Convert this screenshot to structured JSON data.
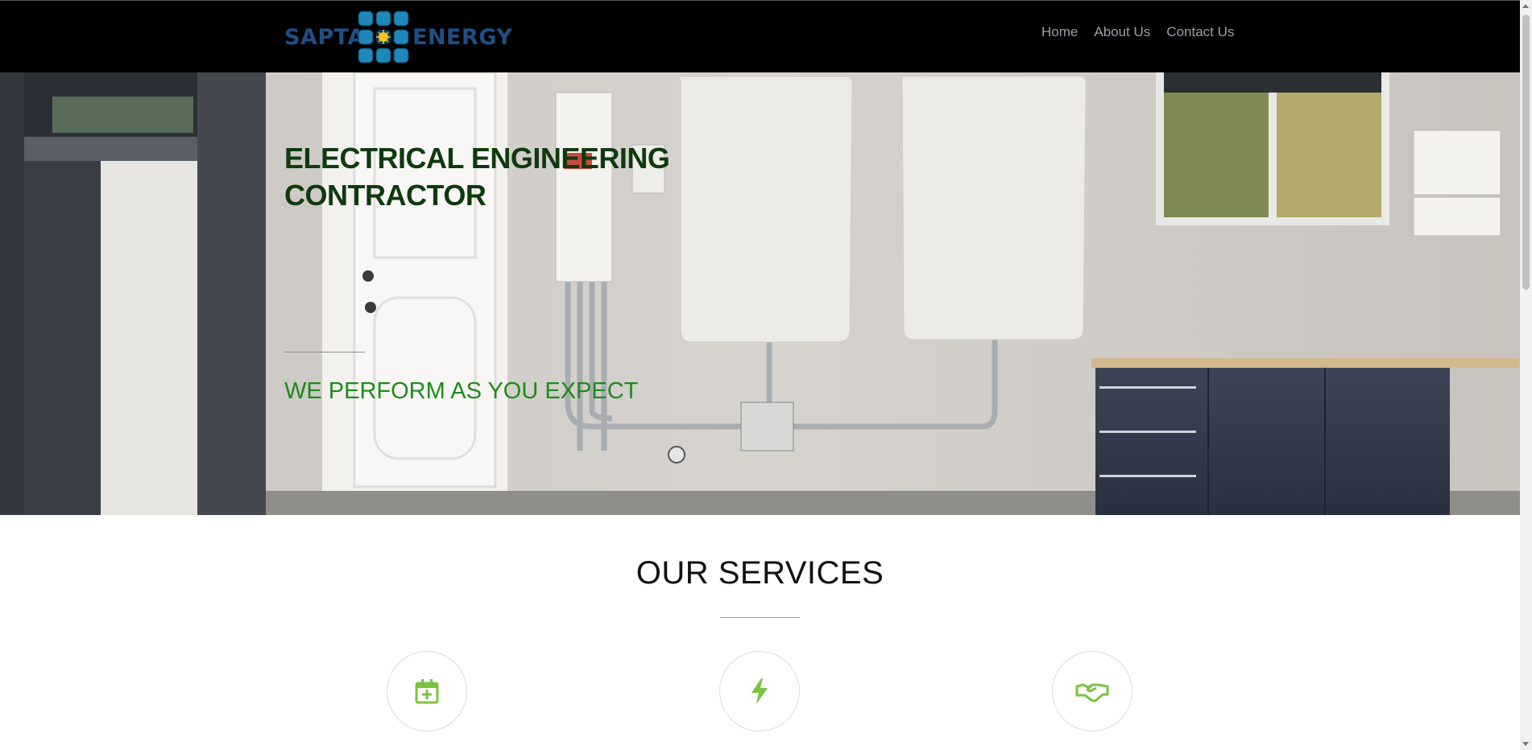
{
  "brand": {
    "name_left": "SAPTA",
    "name_right": "ENERGY",
    "panel_color": "#1e88b8",
    "sun_color": "#f5c518"
  },
  "nav": {
    "items": [
      "Home",
      "About Us",
      "Contact Us"
    ]
  },
  "hero": {
    "title_line1": "ELECTRICAL ENGINEERING",
    "title_line2": "CONTRACTOR",
    "tagline": "WE PERFORM AS YOU EXPECT"
  },
  "services": {
    "title": "OUR SERVICES",
    "icons": [
      "calendar-plus-icon",
      "lightning-bolt-icon",
      "handshake-icon"
    ],
    "icon_color": "#7cc242"
  }
}
